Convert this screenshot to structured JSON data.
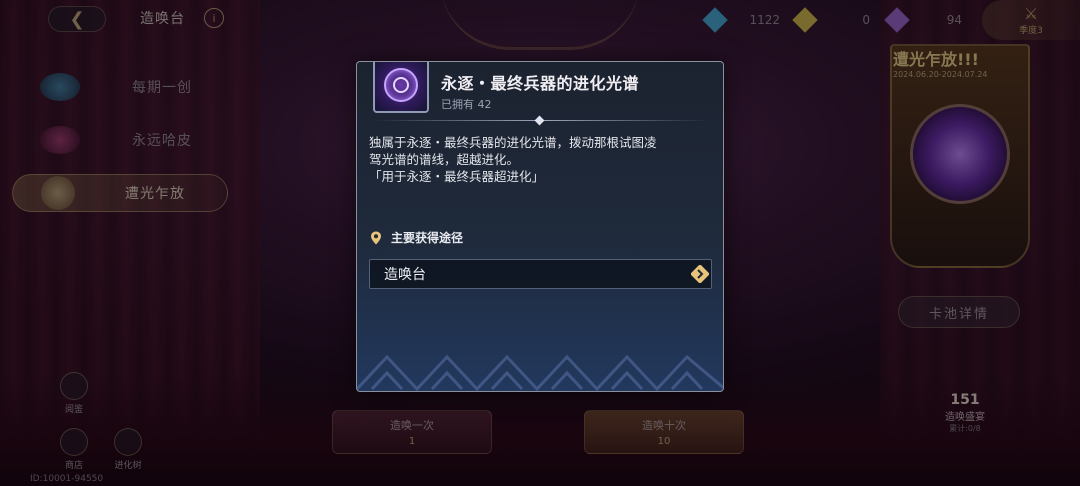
{
  "header": {
    "title": "造唤台",
    "back_icon": "back-arrow-icon",
    "info_icon": "info-icon",
    "info_glyph": "i"
  },
  "sidebar": {
    "items": [
      {
        "label": "每期一创",
        "icon": "diamond-icon"
      },
      {
        "label": "永远哈皮",
        "icon": "heart-icon"
      },
      {
        "label": "遭光乍放",
        "icon": "plus-icon",
        "active": true
      }
    ]
  },
  "resources": [
    {
      "icon": "blue-gem-icon",
      "value": "1122",
      "color": "#4ab0d8"
    },
    {
      "icon": "gold-ticket-icon",
      "value": "0",
      "color": "#d8c24a"
    },
    {
      "icon": "purple-flower-icon",
      "value": "94",
      "color": "#a06ad0"
    }
  ],
  "settings": {
    "label": "季度3"
  },
  "banner": {
    "title": "遭光乍放!!!",
    "date": "2024.06.20-2024.07.24",
    "pool_details_label": "卡池详情"
  },
  "bottom": {
    "side_buttons": [
      {
        "label": "阅鉴"
      },
      {
        "label": "商店"
      },
      {
        "label": "进化树"
      }
    ],
    "pull_one": {
      "label": "造唤一次",
      "cost": "1"
    },
    "pull_ten": {
      "label": "造唤十次",
      "cost": "10"
    },
    "guarantee": {
      "count": "151",
      "label": "造唤盛宴",
      "sub": "累计:0/8"
    },
    "uid": "ID:10001-94550"
  },
  "modal": {
    "item_name": "永逐・最终兵器的进化光谱",
    "owned_label": "已拥有",
    "owned_count": "42",
    "description_line1": "独属于永逐・最终兵器的进化光谱，拨动那根试图凌",
    "description_line2": "驾光谱的谱线，超越进化。",
    "description_line3": "「用于永逐・最终兵器超进化」",
    "source_header": "主要获得途径",
    "source_item": "造唤台",
    "colors": {
      "accent": "#e8c47a",
      "panel_top": "#1c2330",
      "panel_bottom": "#22385e"
    }
  }
}
